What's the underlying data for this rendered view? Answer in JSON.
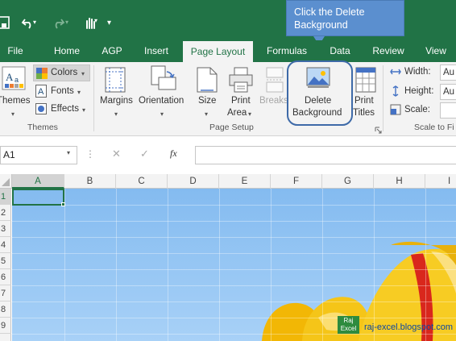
{
  "quick_access": {
    "save_icon": "save-icon",
    "undo_icon": "undo-icon",
    "redo_icon": "redo-icon",
    "touch_icon": "touch-mode-icon",
    "customize": "▾"
  },
  "tabs": [
    "File",
    "Home",
    "AGP",
    "Insert",
    "Page Layout",
    "Formulas",
    "Data",
    "Review",
    "View"
  ],
  "active_tab": "Page Layout",
  "callout": {
    "text": "Click the Delete Background"
  },
  "ribbon": {
    "themes": {
      "themes_label": "Themes",
      "colors_label": "Colors",
      "fonts_label": "Fonts",
      "effects_label": "Effects",
      "group_label": "Themes"
    },
    "page_setup": {
      "margins_label": "Margins",
      "orientation_label": "Orientation",
      "size_label": "Size",
      "print_area_label1": "Print",
      "print_area_label2": "Area",
      "breaks_label": "Breaks",
      "delete_bg_label1": "Delete",
      "delete_bg_label2": "Background",
      "print_titles_label1": "Print",
      "print_titles_label2": "Titles",
      "group_label": "Page Setup"
    },
    "scale_to_fit": {
      "width_label": "Width:",
      "width_value": "Au",
      "height_label": "Height:",
      "height_value": "Au",
      "scale_label": "Scale:",
      "group_label": "Scale to Fi"
    }
  },
  "formula_bar": {
    "name_box": "A1",
    "cancel": "✕",
    "enter": "✓",
    "fx": "fx",
    "value": ""
  },
  "columns": [
    "A",
    "B",
    "C",
    "D",
    "E",
    "F",
    "G",
    "H",
    "I"
  ],
  "rows": [
    "1",
    "2",
    "3",
    "4",
    "5",
    "6",
    "7",
    "8",
    "9"
  ],
  "selected_cell": "A1",
  "watermark": {
    "logo_line1": "Raj",
    "logo_line2": "Excel",
    "url": "raj-excel.blogspot.com"
  },
  "colors": {
    "excel_green": "#217346",
    "callout_blue": "#5b8fcf",
    "sky_blue": "#8ec1f2",
    "petal_yellow": "#f5c31a",
    "petal_red": "#d9271c"
  }
}
